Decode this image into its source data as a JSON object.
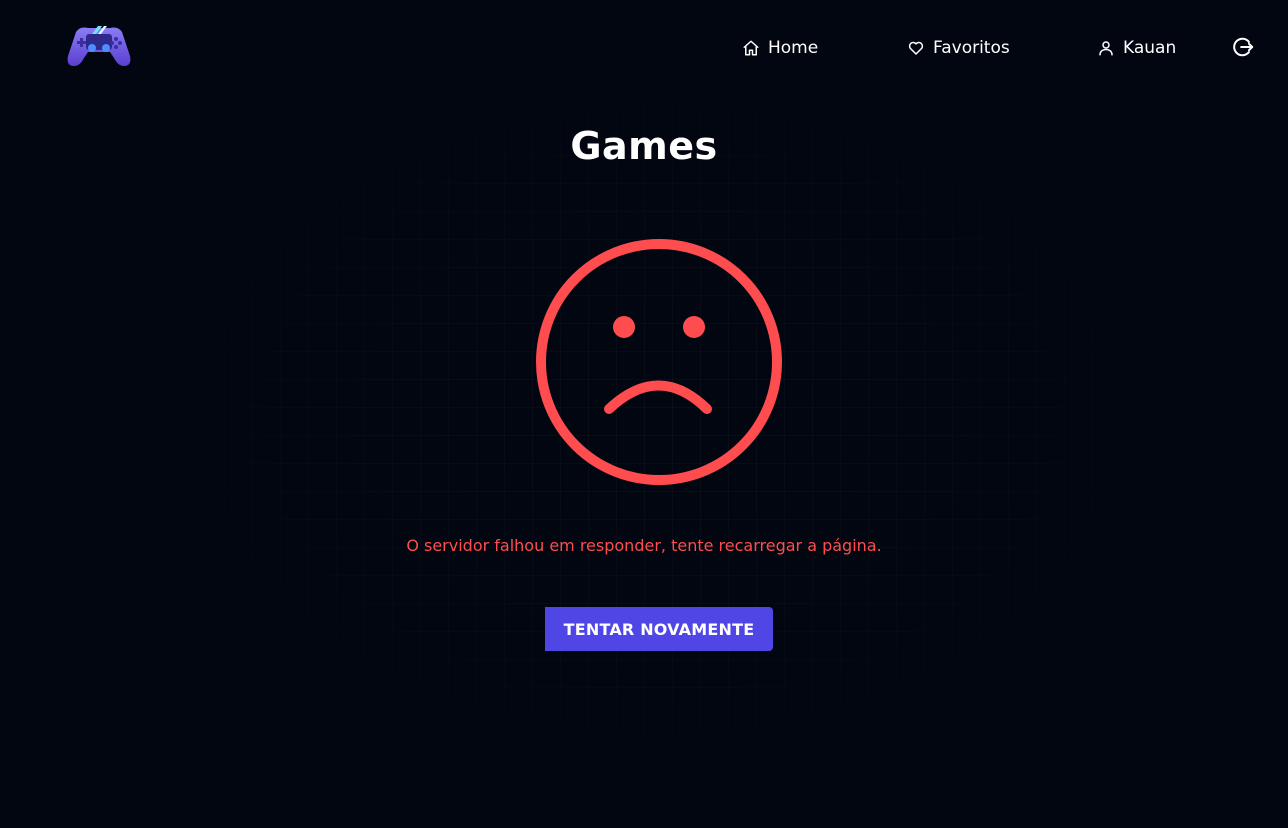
{
  "header": {
    "logo": {
      "icon": "gamepad-icon"
    },
    "nav": [
      {
        "label": "Home",
        "icon": "home-icon"
      },
      {
        "label": "Favoritos",
        "icon": "heart-icon"
      },
      {
        "label": "Kauan",
        "icon": "user-icon"
      }
    ],
    "logout": {
      "icon": "logout-icon"
    }
  },
  "main": {
    "title": "Games",
    "error": {
      "icon": "sad-face-icon",
      "message": "O servidor falhou em responder, tente recarregar a página.",
      "color": "#ff4d4f"
    },
    "retry_button": {
      "label": "TENTAR NOVAMENTE",
      "color": "#4f46e5"
    }
  },
  "colors": {
    "background": "#020610",
    "text": "#ffffff"
  }
}
